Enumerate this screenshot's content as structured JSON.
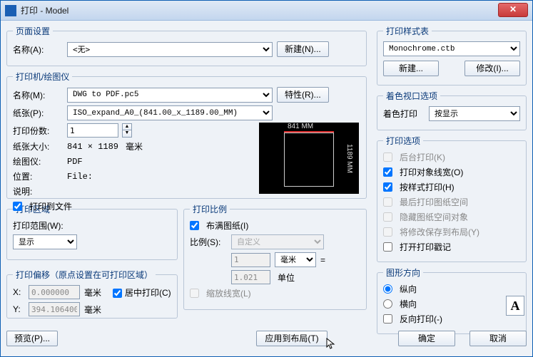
{
  "window": {
    "title": "打印 - Model"
  },
  "page_setup": {
    "legend": "页面设置",
    "name_label": "名称(A):",
    "name_value": "<无>",
    "new_btn": "新建(N)..."
  },
  "printer": {
    "legend": "打印机/绘图仪",
    "name_label": "名称(M):",
    "name_value": "DWG to PDF.pc5",
    "props_btn": "特性(R)...",
    "paper_label": "纸张(P):",
    "paper_value": "ISO_expand_A0_(841.00_x_1189.00_MM)",
    "copies_label": "打印份数:",
    "copies_value": "1",
    "size_label": "纸张大小:",
    "size_value": "841 × 1189",
    "size_unit": "毫米",
    "device_label": "绘图仪:",
    "device_value": "PDF",
    "location_label": "位置:",
    "location_value": "File:",
    "desc_label": "说明:",
    "to_file": "打印到文件",
    "preview_top": "841 MM",
    "preview_right": "1189 MM"
  },
  "area": {
    "legend": "打印区域",
    "range_label": "打印范围(W):",
    "range_value": "显示"
  },
  "scale": {
    "legend": "打印比例",
    "fit": "布满图纸(I)",
    "ratio_label": "比例(S):",
    "ratio_value": "自定义",
    "num1": "1",
    "unit_sel": "毫米",
    "eq": "=",
    "num2": "1.021",
    "unit2": "单位",
    "scale_lw": "缩放线宽(L)"
  },
  "offset": {
    "legend": "打印偏移（原点设置在可打印区域）",
    "x_label": "X:",
    "x_value": "0.000000",
    "y_label": "Y:",
    "y_value": "394.106400",
    "unit": "毫米",
    "center": "居中打印(C)"
  },
  "style_table": {
    "legend": "打印样式表",
    "value": "Monochrome.ctb",
    "new_btn": "新建...",
    "edit_btn": "修改(I)..."
  },
  "shade": {
    "legend": "着色视口选项",
    "label": "着色打印",
    "value": "按显示"
  },
  "options": {
    "legend": "打印选项",
    "bg": "后台打印(K)",
    "lw": "打印对象线宽(O)",
    "styled": "按样式打印(H)",
    "paper_last": "最后打印图纸空间",
    "hide": "隐藏图纸空间对象",
    "save_layout": "将修改保存到布局(Y)",
    "stamp": "打开打印戳记"
  },
  "orient": {
    "legend": "图形方向",
    "portrait": "纵向",
    "landscape": "横向",
    "reverse": "反向打印(-)",
    "icon": "A"
  },
  "buttons": {
    "preview": "预览(P)...",
    "apply": "应用到布局(T)",
    "ok": "确定",
    "cancel": "取消"
  }
}
